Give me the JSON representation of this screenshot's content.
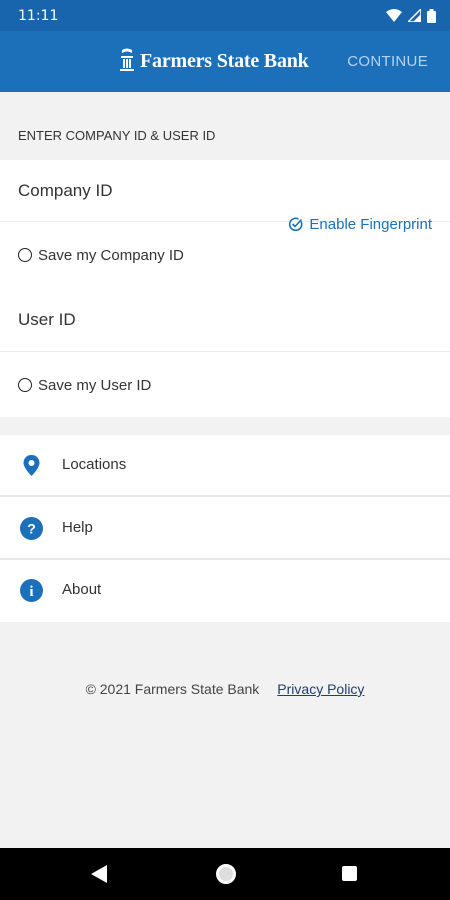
{
  "status_bar": {
    "time": "11:11"
  },
  "app_bar": {
    "brand_name": "Farmers State Bank",
    "continue_label": "CONTINUE"
  },
  "form": {
    "section_header": "ENTER COMPANY ID & USER ID",
    "company_id_label": "Company ID",
    "save_company_label": "Save my Company ID",
    "user_id_label": "User ID",
    "save_user_label": "Save my User ID",
    "fingerprint_label": "Enable Fingerprint"
  },
  "menu": {
    "items": [
      {
        "label": "Locations",
        "icon": "location-pin-icon"
      },
      {
        "label": "Help",
        "icon": "question-icon"
      },
      {
        "label": "About",
        "icon": "info-icon"
      }
    ]
  },
  "footer": {
    "copyright": "© 2021 Farmers State Bank",
    "privacy_label": "Privacy Policy"
  },
  "colors": {
    "primary": "#1c6fb9",
    "status_bar": "#1864ad",
    "background": "#f2f2f2",
    "link": "#1f3d6b"
  }
}
